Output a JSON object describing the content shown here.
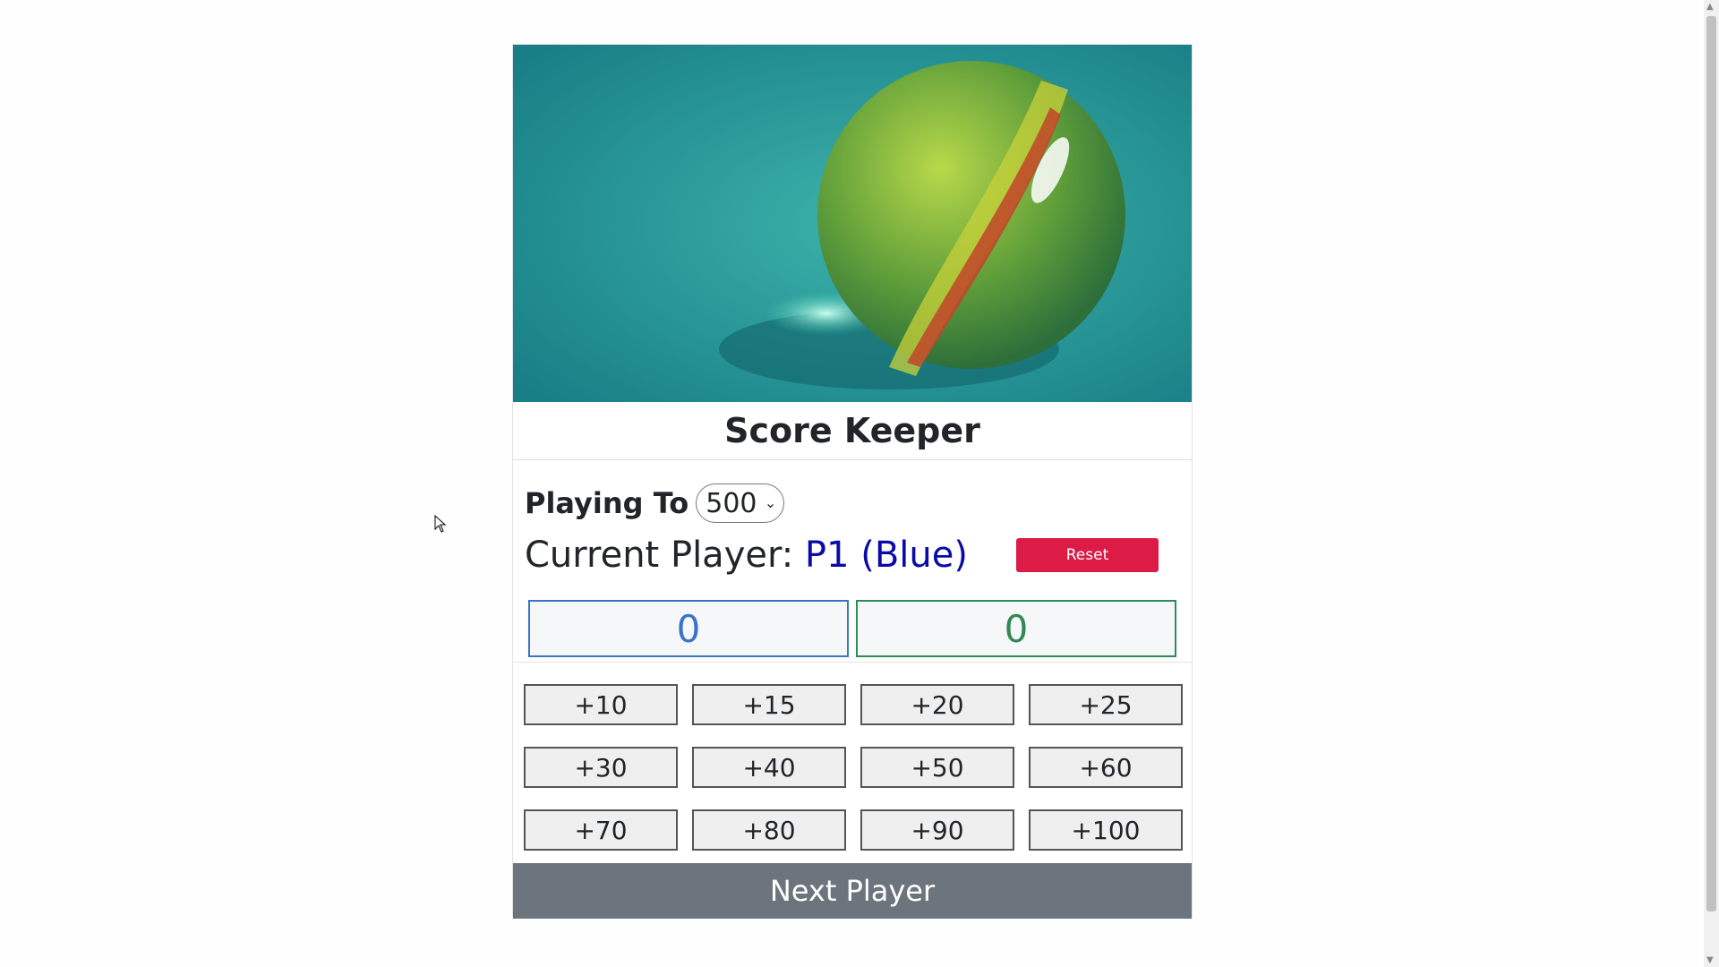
{
  "app": {
    "title": "Score Keeper"
  },
  "settings": {
    "playing_to_label": "Playing To",
    "playing_to_value": "500"
  },
  "status": {
    "current_label": "Current Player:",
    "current_player": "P1 (Blue)",
    "reset_label": "Reset"
  },
  "scores": {
    "p1": "0",
    "p2": "0"
  },
  "point_buttons": [
    "+10",
    "+15",
    "+20",
    "+25",
    "+30",
    "+40",
    "+50",
    "+60",
    "+70",
    "+80",
    "+90",
    "+100"
  ],
  "next_label": "Next Player",
  "colors": {
    "p1": "#3a73c8",
    "p2": "#2f8a55",
    "reset": "#dc1b47",
    "next": "#6c757d"
  },
  "icons": {
    "cursor": "mouse-pointer-icon",
    "select": "chevron-down-icon"
  }
}
